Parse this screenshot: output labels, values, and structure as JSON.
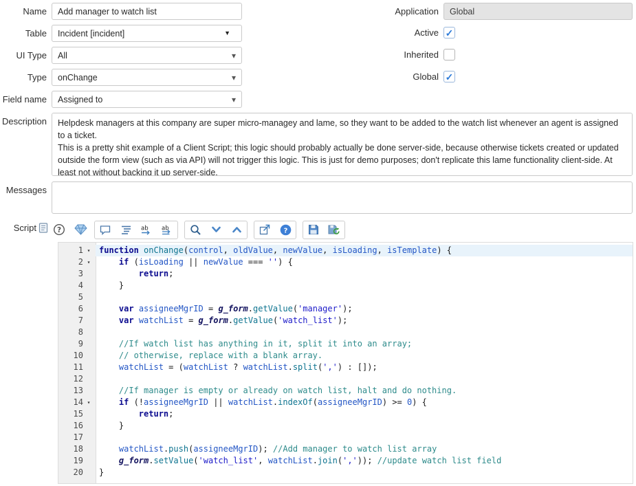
{
  "fields": {
    "name": {
      "label": "Name",
      "value": "Add manager to watch list"
    },
    "table": {
      "label": "Table",
      "value": "Incident [incident]"
    },
    "ui_type": {
      "label": "UI Type",
      "value": "All"
    },
    "type": {
      "label": "Type",
      "value": "onChange"
    },
    "field_name": {
      "label": "Field name",
      "value": "Assigned to"
    },
    "application": {
      "label": "Application",
      "value": "Global"
    },
    "active": {
      "label": "Active",
      "checked": true
    },
    "inherited": {
      "label": "Inherited",
      "checked": false
    },
    "global": {
      "label": "Global",
      "checked": true
    },
    "description": {
      "label": "Description",
      "value": "Helpdesk managers at this company are super micro-managey and lame, so they want to be added to the watch list whenever an agent is assigned to a ticket.\nThis is a pretty shit example of a Client Script; this logic should probably actually be done server-side, because otherwise tickets created or updated outside the form view (such as via API) will not trigger this logic. This is just for demo purposes; don't replicate this lame functionality client-side. At least not without backing it up server-side."
    },
    "messages": {
      "label": "Messages",
      "value": ""
    }
  },
  "script": {
    "label": "Script",
    "toolbar": [
      "help",
      "syntax-editor-macro",
      "toggle-comment",
      "format-code",
      "replace",
      "replace-all",
      "search",
      "find-next",
      "find-previous",
      "open-in-new-window",
      "api-help",
      "save",
      "check-syntax"
    ],
    "lines": [
      {
        "n": 1,
        "fold": true,
        "active": true,
        "t": [
          [
            "k",
            "function"
          ],
          [
            "p",
            " "
          ],
          [
            "f",
            "onChange"
          ],
          [
            "p",
            "("
          ],
          [
            "v",
            "control"
          ],
          [
            "p",
            ", "
          ],
          [
            "v",
            "oldValue"
          ],
          [
            "p",
            ", "
          ],
          [
            "v",
            "newValue"
          ],
          [
            "p",
            ", "
          ],
          [
            "v",
            "isLoading"
          ],
          [
            "p",
            ", "
          ],
          [
            "v",
            "isTemplate"
          ],
          [
            "p",
            ") {"
          ]
        ]
      },
      {
        "n": 2,
        "fold": true,
        "t": [
          [
            "p",
            "    "
          ],
          [
            "k",
            "if"
          ],
          [
            "p",
            " ("
          ],
          [
            "v",
            "isLoading"
          ],
          [
            "p",
            " || "
          ],
          [
            "v",
            "newValue"
          ],
          [
            "p",
            " === "
          ],
          [
            "s",
            "''"
          ],
          [
            "p",
            ") {"
          ]
        ]
      },
      {
        "n": 3,
        "t": [
          [
            "p",
            "        "
          ],
          [
            "k",
            "return"
          ],
          [
            "p",
            ";"
          ]
        ]
      },
      {
        "n": 4,
        "t": [
          [
            "p",
            "    }"
          ]
        ]
      },
      {
        "n": 5,
        "t": []
      },
      {
        "n": 6,
        "t": [
          [
            "p",
            "    "
          ],
          [
            "k",
            "var"
          ],
          [
            "p",
            " "
          ],
          [
            "v",
            "assigneeMgrID"
          ],
          [
            "p",
            " = "
          ],
          [
            "g",
            "g_form"
          ],
          [
            "p",
            "."
          ],
          [
            "f",
            "getValue"
          ],
          [
            "p",
            "("
          ],
          [
            "s",
            "'manager'"
          ],
          [
            "p",
            ");"
          ]
        ]
      },
      {
        "n": 7,
        "t": [
          [
            "p",
            "    "
          ],
          [
            "k",
            "var"
          ],
          [
            "p",
            " "
          ],
          [
            "v",
            "watchList"
          ],
          [
            "p",
            " = "
          ],
          [
            "g",
            "g_form"
          ],
          [
            "p",
            "."
          ],
          [
            "f",
            "getValue"
          ],
          [
            "p",
            "("
          ],
          [
            "s",
            "'watch_list'"
          ],
          [
            "p",
            ");"
          ]
        ]
      },
      {
        "n": 8,
        "t": []
      },
      {
        "n": 9,
        "t": [
          [
            "p",
            "    "
          ],
          [
            "c",
            "//If watch list has anything in it, split it into an array;"
          ]
        ]
      },
      {
        "n": 10,
        "t": [
          [
            "p",
            "    "
          ],
          [
            "c",
            "// otherwise, replace with a blank array."
          ]
        ]
      },
      {
        "n": 11,
        "t": [
          [
            "p",
            "    "
          ],
          [
            "v",
            "watchList"
          ],
          [
            "p",
            " = ("
          ],
          [
            "v",
            "watchList"
          ],
          [
            "p",
            " ? "
          ],
          [
            "v",
            "watchList"
          ],
          [
            "p",
            "."
          ],
          [
            "f",
            "split"
          ],
          [
            "p",
            "("
          ],
          [
            "s",
            "','"
          ],
          [
            "p",
            ") : []);"
          ]
        ]
      },
      {
        "n": 12,
        "t": []
      },
      {
        "n": 13,
        "t": [
          [
            "p",
            "    "
          ],
          [
            "c",
            "//If manager is empty or already on watch list, halt and do nothing."
          ]
        ]
      },
      {
        "n": 14,
        "fold": true,
        "t": [
          [
            "p",
            "    "
          ],
          [
            "k",
            "if"
          ],
          [
            "p",
            " (!"
          ],
          [
            "v",
            "assigneeMgrID"
          ],
          [
            "p",
            " || "
          ],
          [
            "v",
            "watchList"
          ],
          [
            "p",
            "."
          ],
          [
            "f",
            "indexOf"
          ],
          [
            "p",
            "("
          ],
          [
            "v",
            "assigneeMgrID"
          ],
          [
            "p",
            ") >= "
          ],
          [
            "n",
            "0"
          ],
          [
            "p",
            ") {"
          ]
        ]
      },
      {
        "n": 15,
        "t": [
          [
            "p",
            "        "
          ],
          [
            "k",
            "return"
          ],
          [
            "p",
            ";"
          ]
        ]
      },
      {
        "n": 16,
        "t": [
          [
            "p",
            "    }"
          ]
        ]
      },
      {
        "n": 17,
        "t": []
      },
      {
        "n": 18,
        "t": [
          [
            "p",
            "    "
          ],
          [
            "v",
            "watchList"
          ],
          [
            "p",
            "."
          ],
          [
            "f",
            "push"
          ],
          [
            "p",
            "("
          ],
          [
            "v",
            "assigneeMgrID"
          ],
          [
            "p",
            "); "
          ],
          [
            "c",
            "//Add manager to watch list array"
          ]
        ]
      },
      {
        "n": 19,
        "t": [
          [
            "p",
            "    "
          ],
          [
            "g",
            "g_form"
          ],
          [
            "p",
            "."
          ],
          [
            "f",
            "setValue"
          ],
          [
            "p",
            "("
          ],
          [
            "s",
            "'watch_list'"
          ],
          [
            "p",
            ", "
          ],
          [
            "v",
            "watchList"
          ],
          [
            "p",
            "."
          ],
          [
            "f",
            "join"
          ],
          [
            "p",
            "("
          ],
          [
            "s",
            "','"
          ],
          [
            "p",
            ")); "
          ],
          [
            "c",
            "//update watch list field"
          ]
        ]
      },
      {
        "n": 20,
        "t": [
          [
            "p",
            "}"
          ]
        ]
      }
    ]
  },
  "colors": {
    "accent_blue": "#2d7bd9",
    "readonly_bg": "#e4e4e4",
    "gutter_bg": "#f0f0f0",
    "active_line_bg": "#e8f3fb",
    "keyword": "#0b0b8f",
    "function_name": "#0e7490",
    "variable": "#2356c5",
    "string": "#1d1bc9",
    "comment": "#2e8b8b",
    "g_form": "#12125e"
  }
}
